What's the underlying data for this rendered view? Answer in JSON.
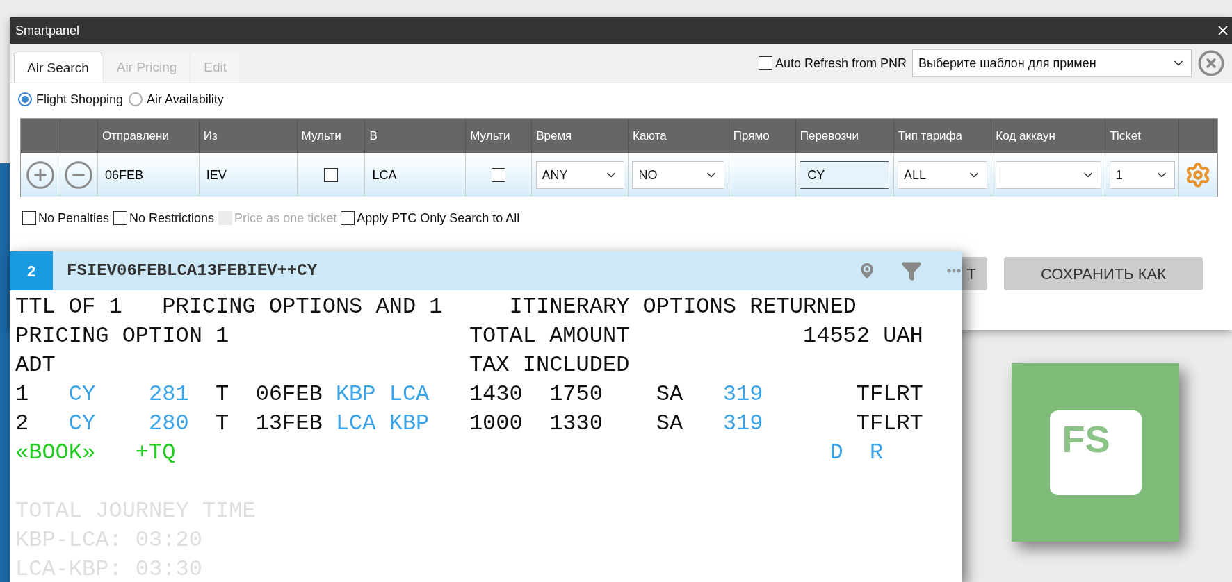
{
  "window": {
    "title": "Smartpanel"
  },
  "tabs": [
    {
      "label": "Air Search",
      "selected": true,
      "disabled": false
    },
    {
      "label": "Air Pricing",
      "selected": false,
      "disabled": true
    },
    {
      "label": "Edit",
      "selected": false,
      "disabled": true
    }
  ],
  "auto_refresh": {
    "label": "Auto Refresh from PNR",
    "checked": false
  },
  "template_select": {
    "value": "Выберите шаблон для примен"
  },
  "search_modes": [
    {
      "label": "Flight Shopping",
      "selected": true
    },
    {
      "label": "Air Availability",
      "selected": false
    }
  ],
  "table": {
    "columns": [
      {},
      {},
      {
        "label": "Отправлени"
      },
      {
        "label": "Из"
      },
      {
        "label": "Мульти"
      },
      {
        "label": "В"
      },
      {
        "label": "Мульти"
      },
      {
        "label": "Время"
      },
      {
        "label": "Каюта"
      },
      {
        "label": "Прямо"
      },
      {
        "label": "Перевозчи"
      },
      {
        "label": "Тип тарифа"
      },
      {
        "label": "Код аккаун"
      },
      {
        "label": "Ticket"
      },
      {}
    ],
    "row": [
      {
        "kind": "add"
      },
      {
        "kind": "remove"
      },
      {
        "kind": "text",
        "value": "06FEB"
      },
      {
        "kind": "text",
        "value": "IEV"
      },
      {
        "kind": "checkbox",
        "checked": false
      },
      {
        "kind": "text",
        "value": "LCA"
      },
      {
        "kind": "checkbox",
        "checked": false
      },
      {
        "kind": "select",
        "value": "ANY"
      },
      {
        "kind": "select",
        "value": "NO"
      },
      {
        "kind": "empty"
      },
      {
        "kind": "field",
        "value": "CY"
      },
      {
        "kind": "select",
        "value": "ALL"
      },
      {
        "kind": "select"
      },
      {
        "kind": "select",
        "value": "1"
      },
      {
        "kind": "gear"
      }
    ]
  },
  "options": [
    {
      "label": "No Penalties",
      "checked": false,
      "disabled": false
    },
    {
      "label": "No Restrictions",
      "checked": false,
      "disabled": false
    },
    {
      "label": "Price as one ticket",
      "checked": false,
      "disabled": true
    },
    {
      "label": "Apply PTC Only Search to All",
      "checked": false,
      "disabled": false
    }
  ],
  "buttons": [
    {
      "label": "T"
    },
    {
      "label": "СОХРАНИТЬ КАК"
    }
  ],
  "terminal": {
    "tab_number": "2",
    "command": "FSIEV06FEBLCA13FEBIEV++CY",
    "lines": [
      [
        {
          "text": "TTL OF 1   PRICING OPTIONS AND 1     ITINERARY OPTIONS RETURNED",
          "kind": "plain"
        }
      ],
      [
        {
          "text": "PRICING OPTION 1                  TOTAL AMOUNT             14552 UAH",
          "kind": "plain"
        }
      ],
      [
        {
          "text": "ADT                               TAX INCLUDED",
          "kind": "plain"
        }
      ],
      [
        {
          "text": "1   ",
          "kind": "plain"
        },
        {
          "text": "CY    281",
          "kind": "link"
        },
        {
          "text": "  T  06FEB ",
          "kind": "plain"
        },
        {
          "text": "KBP LCA",
          "kind": "link"
        },
        {
          "text": "   1430  1750    SA   ",
          "kind": "plain"
        },
        {
          "text": "319",
          "kind": "link"
        },
        {
          "text": "       TFLRT",
          "kind": "plain"
        }
      ],
      [
        {
          "text": "2   ",
          "kind": "plain"
        },
        {
          "text": "CY    280",
          "kind": "link"
        },
        {
          "text": "  T  13FEB ",
          "kind": "plain"
        },
        {
          "text": "LCA KBP",
          "kind": "link"
        },
        {
          "text": "   1000  1330    SA   ",
          "kind": "plain"
        },
        {
          "text": "319",
          "kind": "link"
        },
        {
          "text": "       TFLRT",
          "kind": "plain"
        }
      ],
      [
        {
          "text": "«BOOK»   +TQ",
          "kind": "command"
        },
        {
          "text": "                                                 D  R",
          "kind": "link"
        }
      ]
    ],
    "journey_lines": [
      [
        {
          "text": "TOTAL JOURNEY TIME",
          "kind": "dim"
        }
      ],
      [
        {
          "text": "KBP-LCA: 03:20",
          "kind": "dim"
        }
      ],
      [
        {
          "text": "LCA-KBP: 03:30",
          "kind": "dim"
        }
      ]
    ]
  },
  "app_tile": {
    "label": "FS"
  }
}
